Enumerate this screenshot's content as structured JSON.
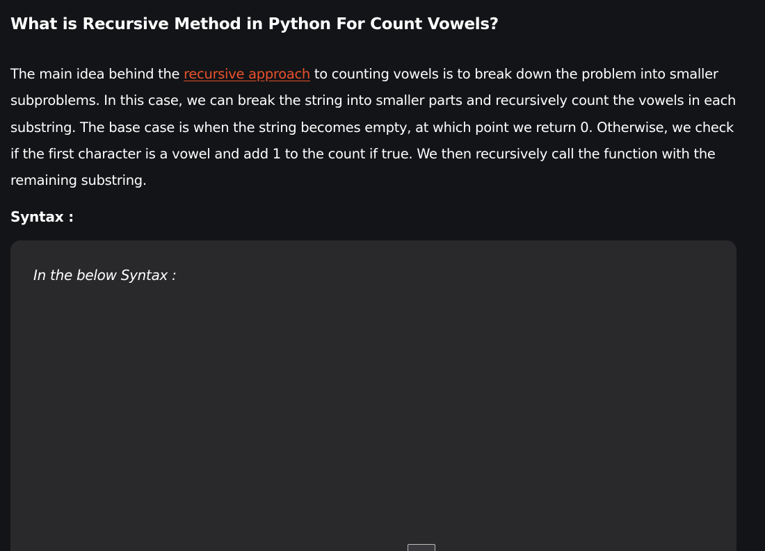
{
  "article": {
    "heading": "What is Recursive Method in Python For Count Vowels?",
    "paragraph": {
      "before_link": "The main idea behind the ",
      "link_text": "recursive approach",
      "after_link": " to counting vowels is to break down the problem into smaller subproblems. In this case, we can break the string into smaller parts and recursively count the vowels in each substring. The base case is when the string becomes empty, at which point we return 0. Otherwise, we check if the first character is a vowel and add 1 to the count if true. We then recursively call the function with the remaining substring."
    },
    "syntax_label": "Syntax :",
    "code_box": {
      "note": "In the below Syntax :"
    }
  },
  "colors": {
    "background": "#131417",
    "code_box": "#29292c",
    "link": "#e9522c",
    "text": "#ffffff"
  }
}
